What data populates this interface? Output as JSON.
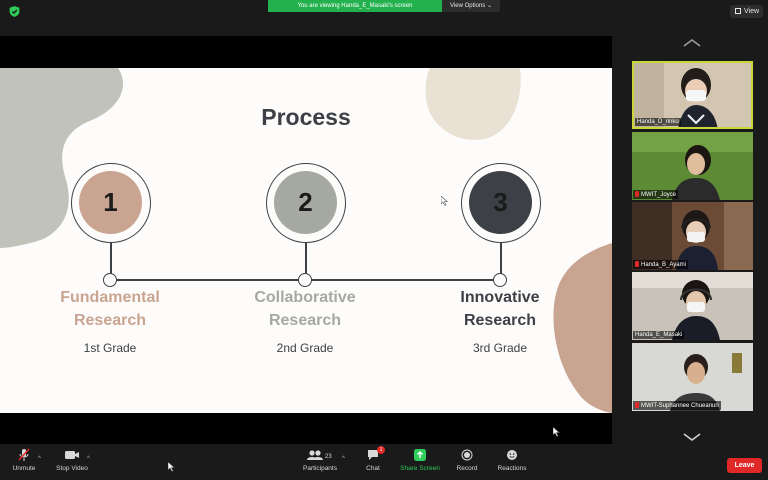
{
  "topbar": {
    "banner_text": "You are viewing Handa_E_Masaki's screen",
    "view_options_label": "View Options",
    "view_button_label": "View"
  },
  "slide": {
    "title": "Process",
    "steps": [
      {
        "number": "1",
        "label_line1": "Fundamental",
        "label_line2": "Research",
        "grade": "1st Grade",
        "disc_color": "#c9a491",
        "label_color": "#c9a491"
      },
      {
        "number": "2",
        "label_line1": "Collaborative",
        "label_line2": "Research",
        "grade": "2nd Grade",
        "disc_color": "#a6a9a2",
        "label_color": "#a6a9a2"
      },
      {
        "number": "3",
        "label_line1": "Innovative",
        "label_line2": "Research",
        "grade": "3rd Grade",
        "disc_color": "#3d4147",
        "label_color": "#3d4147"
      }
    ]
  },
  "gallery": {
    "participants": [
      {
        "name": "Handa_D_rinko",
        "muted": false,
        "active": true
      },
      {
        "name": "MWIT_Joyce",
        "muted": true,
        "active": false
      },
      {
        "name": "Handa_B_Ayami",
        "muted": true,
        "active": false
      },
      {
        "name": "Handa_E_Masaki",
        "muted": false,
        "active": false
      },
      {
        "name": "MWIT-Suphannee Chueanun",
        "muted": true,
        "active": false
      }
    ]
  },
  "toolbar": {
    "unmute": "Unmute",
    "stop_video": "Stop Video",
    "participants": "Participants",
    "participants_count": "23",
    "chat": "Chat",
    "chat_badge": "1",
    "share_screen": "Share Screen",
    "record": "Record",
    "reactions": "Reactions",
    "leave": "Leave"
  }
}
